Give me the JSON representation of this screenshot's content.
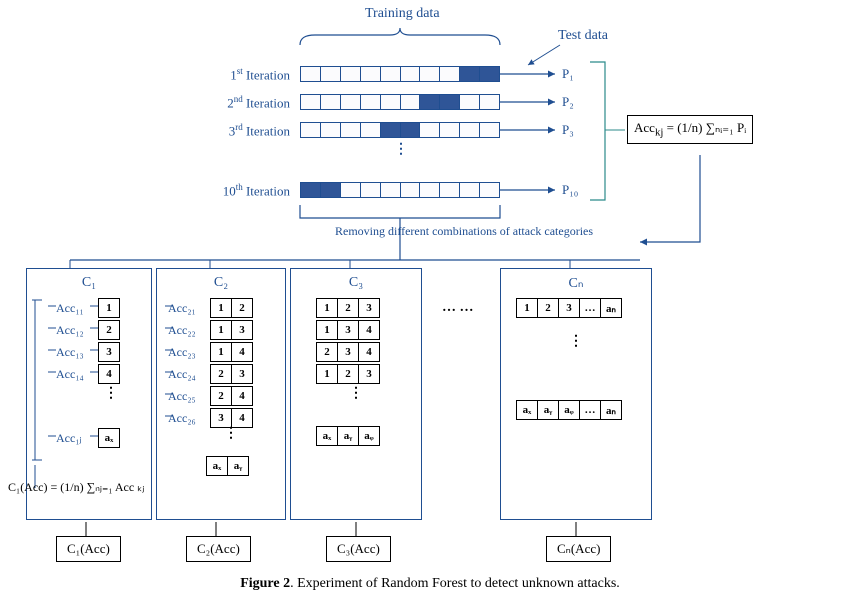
{
  "labels": {
    "training": "Training data",
    "test": "Test data",
    "removing": "Removing different combinations of attack categories",
    "iter1": "1<sup>st</sup>  Iteration",
    "iter2": "2<sup>nd</sup>  Iteration",
    "iter3": "3<sup>rd</sup>  Iteration",
    "iter10": "10<sup>th</sup>  Iteration",
    "p1": "P₁",
    "p2": "P₂",
    "p3": "P₃",
    "p10": "P₁₀",
    "acc_formula": "Acc<sub>kj</sub> = (1/n) ∑ₙᵢ₌₁ Pᵢ",
    "c1": "C₁",
    "c2": "C₂",
    "c3": "C₃",
    "cn": "Cₙ",
    "c1_out": "C₁(Acc)",
    "c2_out": "C₂(Acc)",
    "c3_out": "C₃(Acc)",
    "cn_out": "Cₙ(Acc)",
    "c1_formula": "C₁(Acc) = (1/n) ∑ₙⱼ₌₁ Acc ₖⱼ",
    "caption_prefix": "Figure 2",
    "caption_body": ". Experiment of Random Forest to detect unknown attacks."
  },
  "panels": {
    "c1_acc": [
      "Acc₁₁",
      "Acc₁₂",
      "Acc₁₃",
      "Acc₁₄",
      "Acc₁ⱼ"
    ],
    "c2_acc": [
      "Acc₂₁",
      "Acc₂₂",
      "Acc₂₃",
      "Acc₂₄",
      "Acc₂₅",
      "Acc₂₆"
    ]
  },
  "chips": {
    "c1": [
      "1",
      "2",
      "3",
      "4",
      "aₓ"
    ],
    "c2": [
      [
        "1",
        "2"
      ],
      [
        "1",
        "3"
      ],
      [
        "1",
        "4"
      ],
      [
        "2",
        "3"
      ],
      [
        "2",
        "4"
      ],
      [
        "3",
        "4"
      ],
      [
        "aₓ",
        "aᵧ"
      ]
    ],
    "c3": [
      [
        "1",
        "2",
        "3"
      ],
      [
        "1",
        "3",
        "4"
      ],
      [
        "2",
        "3",
        "4"
      ],
      [
        "1",
        "2",
        "3"
      ],
      [
        "aₓ",
        "aᵧ",
        "aᵩ"
      ]
    ],
    "cn": [
      [
        "1",
        "2",
        "3",
        "…",
        "aₙ"
      ],
      [
        "aₓ",
        "aᵧ",
        "aᵩ",
        "…",
        "aₙ"
      ]
    ]
  },
  "splits": {
    "total": 10,
    "rows": [
      {
        "fill_start": 8,
        "fill_len": 2
      },
      {
        "fill_start": 6,
        "fill_len": 2
      },
      {
        "fill_start": 4,
        "fill_len": 2
      },
      {
        "fill_start": 0,
        "fill_len": 2
      }
    ]
  }
}
